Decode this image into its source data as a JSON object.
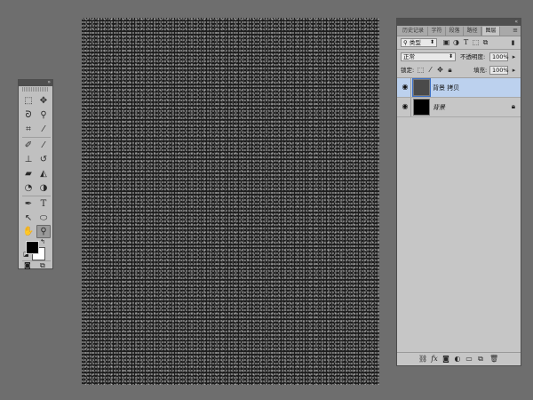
{
  "tools_panel": {
    "tools": [
      {
        "icon": "rectangular-marquee-icon",
        "glyph": "⬚"
      },
      {
        "icon": "move-icon",
        "glyph": "✥"
      },
      {
        "icon": "lasso-icon",
        "glyph": "ᘐ"
      },
      {
        "icon": "quick-selection-icon",
        "glyph": "⚲"
      },
      {
        "icon": "crop-icon",
        "glyph": "⌗"
      },
      {
        "icon": "eyedropper-icon",
        "glyph": "⁄"
      },
      {
        "icon": "healing-brush-icon",
        "glyph": "✐"
      },
      {
        "icon": "brush-icon",
        "glyph": "⁄"
      },
      {
        "icon": "clone-stamp-icon",
        "glyph": "⊥"
      },
      {
        "icon": "history-brush-icon",
        "glyph": "↺"
      },
      {
        "icon": "eraser-icon",
        "glyph": "▰"
      },
      {
        "icon": "paint-bucket-icon",
        "glyph": "◭"
      },
      {
        "icon": "blur-icon",
        "glyph": "◔"
      },
      {
        "icon": "dodge-icon",
        "glyph": "◑"
      },
      {
        "icon": "pen-icon",
        "glyph": "✒"
      },
      {
        "icon": "type-icon",
        "glyph": "T"
      },
      {
        "icon": "path-selection-icon",
        "glyph": "↖"
      },
      {
        "icon": "ellipse-shape-icon",
        "glyph": "⬭"
      },
      {
        "icon": "hand-icon",
        "glyph": "✋"
      },
      {
        "icon": "zoom-icon",
        "glyph": "⚲"
      }
    ],
    "active_tool": "zoom-icon",
    "foreground_color": "#000000",
    "background_color": "#ffffff"
  },
  "layers_panel": {
    "tabs": [
      "历史记录",
      "字符",
      "段落",
      "路径",
      "图层"
    ],
    "active_tab": "图层",
    "filter_kind": "类型",
    "blend_mode": "正常",
    "opacity_label": "不透明度:",
    "opacity_value": "100%",
    "lock_label": "锁定:",
    "fill_label": "填充:",
    "fill_value": "100%",
    "layers": [
      {
        "name": "背景 拷贝",
        "thumbnail": "noise",
        "visible": true,
        "selected": true,
        "locked": false
      },
      {
        "name": "背景",
        "thumbnail": "black",
        "visible": true,
        "selected": false,
        "locked": true
      }
    ],
    "footer_icons": [
      "link-icon",
      "fx-icon",
      "mask-icon",
      "adjustment-icon",
      "group-folder-icon",
      "new-layer-icon",
      "trash-icon"
    ],
    "fx_label": "fx"
  },
  "colors": {
    "workspace": "#6e6e6e",
    "panel": "#c6c6c6",
    "selected_layer": "#bcd1ee",
    "canvas_base": "#1d1d1d"
  }
}
